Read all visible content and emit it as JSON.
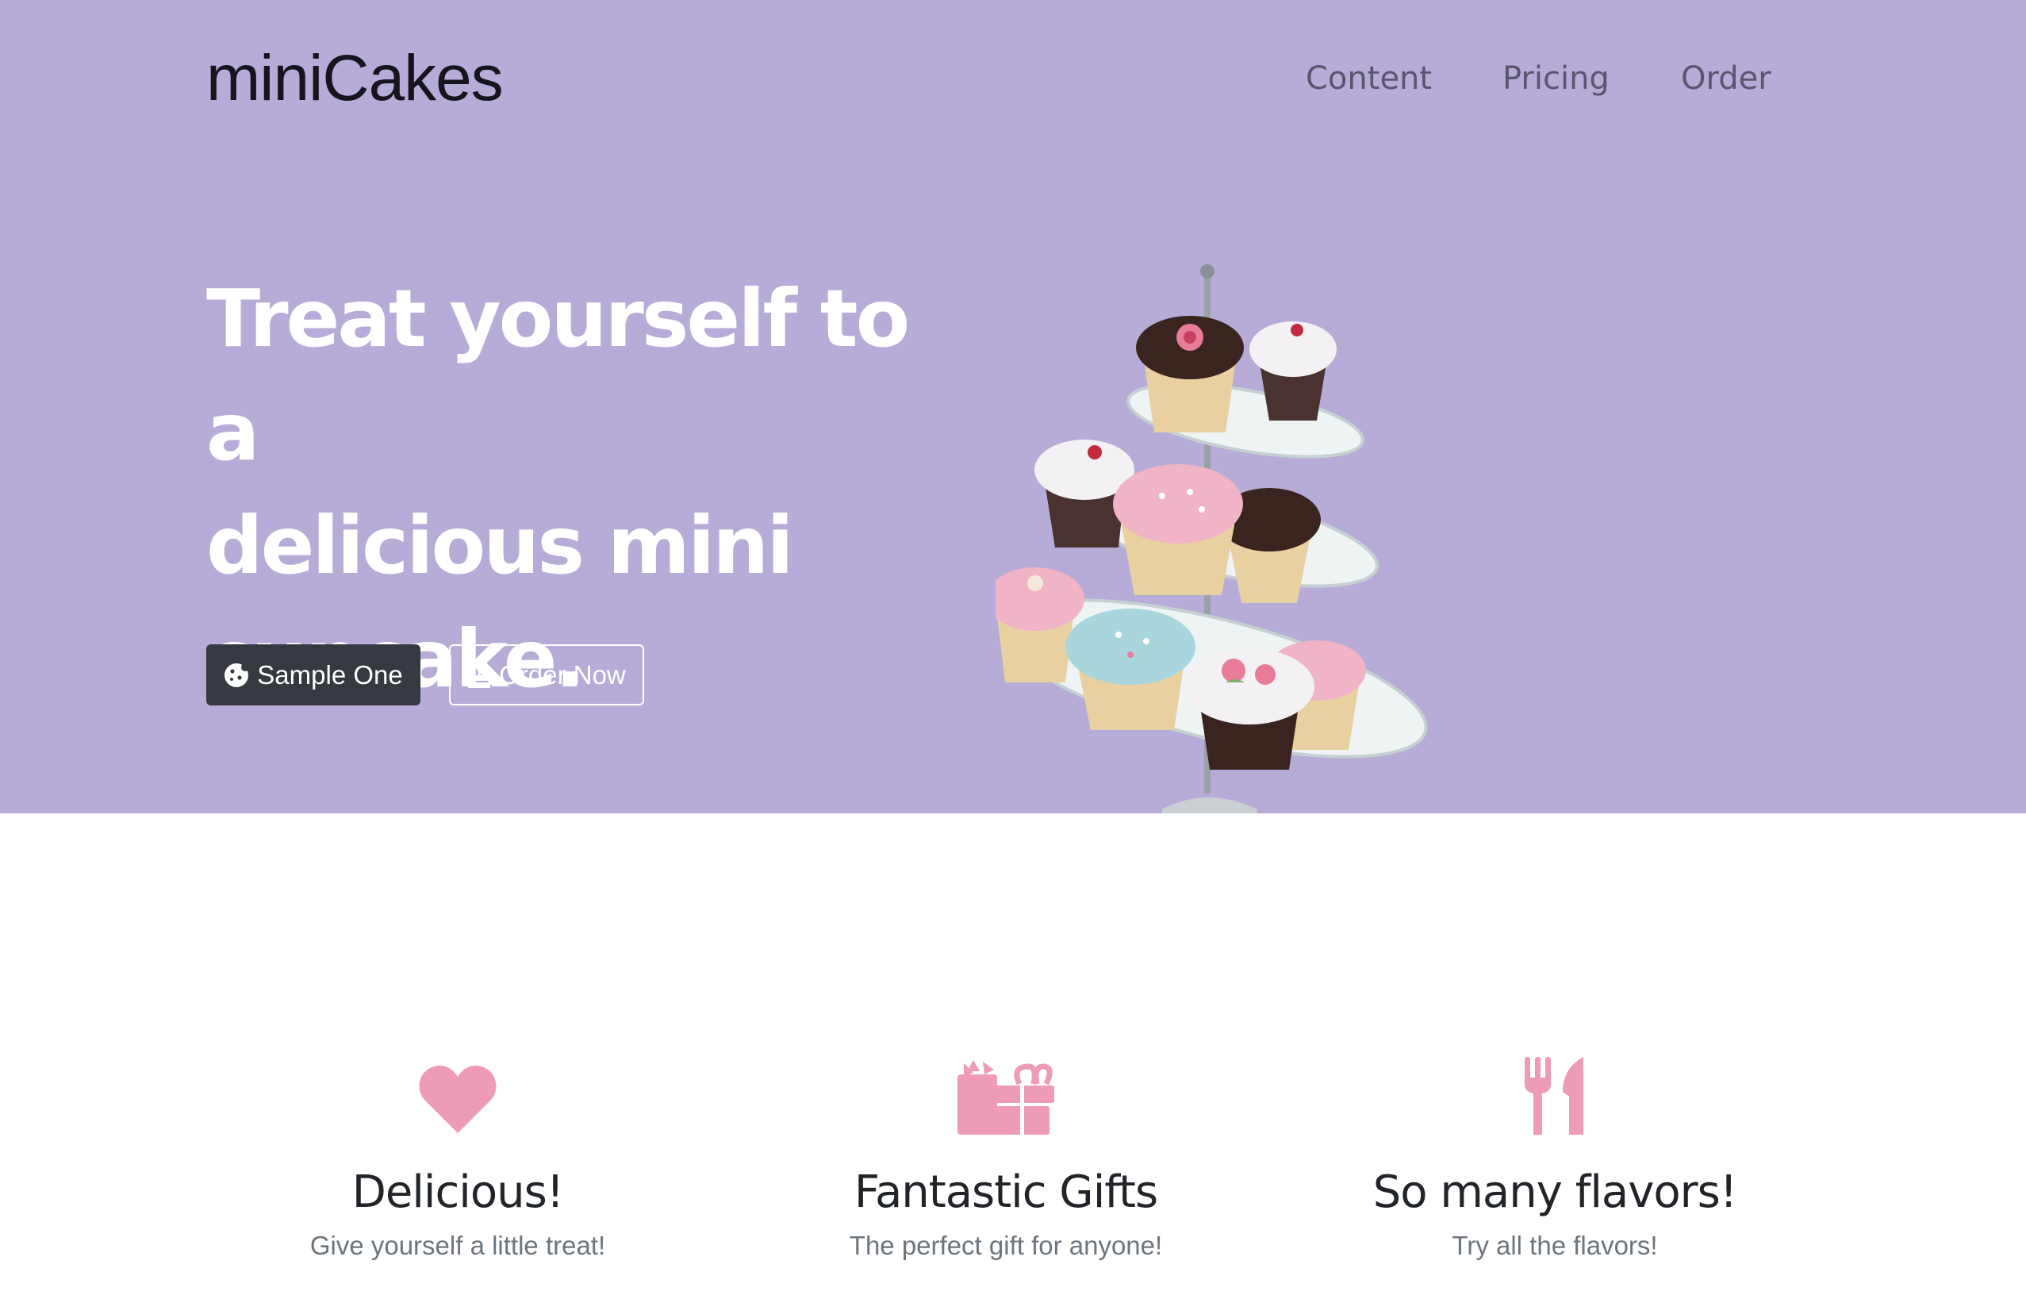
{
  "brand": "miniCakes",
  "nav": {
    "items": [
      "Content",
      "Pricing",
      "Order"
    ]
  },
  "hero": {
    "headline_lines": [
      "Treat yourself to a",
      "delicious mini",
      "cupcake."
    ],
    "buttons": {
      "sample": "Sample One",
      "order": "Order Now"
    },
    "image_alt": "tiered cupcake stand"
  },
  "features": [
    {
      "icon": "heart-icon",
      "title": "Delicious!",
      "subtitle": "Give yourself a little treat!"
    },
    {
      "icon": "gifts-icon",
      "title": "Fantastic Gifts",
      "subtitle": "The perfect gift for anyone!"
    },
    {
      "icon": "utensils-icon",
      "title": "So many flavors!",
      "subtitle": "Try all the flavors!"
    }
  ],
  "colors": {
    "hero_bg": "#b7acd7",
    "dark_button": "#343a40",
    "icon_pink": "#ee9bb5",
    "muted_text": "#6c757d"
  }
}
